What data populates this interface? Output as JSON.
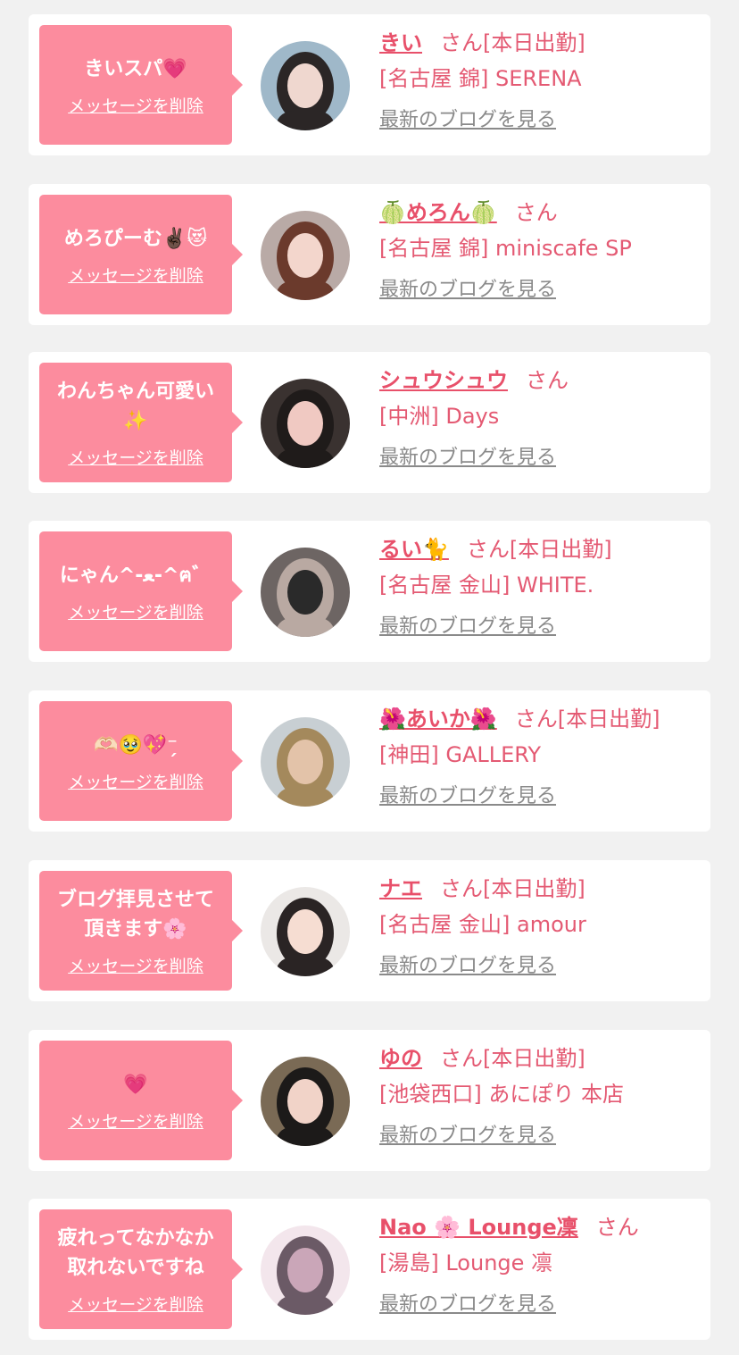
{
  "items": [
    {
      "message": "きいスパ💗",
      "delete_label": "メッセージを削除",
      "name": "きい",
      "honorific": "さん",
      "status": "[本日出勤]",
      "shop": "[名古屋 錦] SERENA",
      "blog_label": "最新のブログを見る",
      "avatar_colors": [
        "#9fb8c9",
        "#2b2626",
        "#efd7cf"
      ]
    },
    {
      "message": "めろぴーむ✌🏿😻",
      "delete_label": "メッセージを削除",
      "name": "🍈めろん🍈",
      "honorific": "さん",
      "status": "",
      "shop": "[名古屋 錦] miniscafe SP",
      "blog_label": "最新のブログを見る",
      "avatar_colors": [
        "#b9aaa6",
        "#6b3a2c",
        "#f3d6cc"
      ]
    },
    {
      "message": "わんちゃん可愛い\n✨",
      "delete_label": "メッセージを削除",
      "name": "シュウシュウ",
      "honorific": "さん",
      "status": "",
      "shop": "[中洲] Days",
      "blog_label": "最新のブログを見る",
      "avatar_colors": [
        "#3a3230",
        "#1f1b1a",
        "#f0c9c2"
      ]
    },
    {
      "message": "にゃん^-ﻌ-^ฅ゛",
      "delete_label": "メッセージを削除",
      "name": "るい🐈",
      "honorific": "さん",
      "status": "[本日出勤]",
      "shop": "[名古屋 金山] WHITE.",
      "blog_label": "最新のブログを見る",
      "avatar_colors": [
        "#6d6563",
        "#b9a9a2",
        "#2a2a2a"
      ]
    },
    {
      "message": "🫶🏻🥹💖⁻̗",
      "delete_label": "メッセージを削除",
      "name": "🌺あいか🌺",
      "honorific": "さん",
      "status": "[本日出勤]",
      "shop": "[神田] GALLERY",
      "blog_label": "最新のブログを見る",
      "avatar_colors": [
        "#c8cfd3",
        "#a4895c",
        "#e3c3a9"
      ]
    },
    {
      "message": "ブログ拝見させて\n頂きます🌸",
      "delete_label": "メッセージを削除",
      "name": "ナエ",
      "honorific": "さん",
      "status": "[本日出勤]",
      "shop": "[名古屋 金山] amour",
      "blog_label": "最新のブログを見る",
      "avatar_colors": [
        "#ebe8e6",
        "#2a2424",
        "#f6ddd2"
      ]
    },
    {
      "message": "💗",
      "delete_label": "メッセージを削除",
      "name": "ゆの",
      "honorific": "さん",
      "status": "[本日出勤]",
      "shop": "[池袋西口] あにぽり 本店",
      "blog_label": "最新のブログを見る",
      "avatar_colors": [
        "#7a6a55",
        "#1c1a19",
        "#f1d3c8"
      ]
    },
    {
      "message": "疲れってなかなか\n取れないですね",
      "delete_label": "メッセージを削除",
      "name": "Nao 🌸 Lounge凜",
      "honorific": "さん",
      "status": "",
      "shop": "[湯島] Lounge 凛",
      "blog_label": "最新のブログを見る",
      "avatar_colors": [
        "#f3e6ec",
        "#6b5a66",
        "#caa6b8"
      ]
    }
  ]
}
